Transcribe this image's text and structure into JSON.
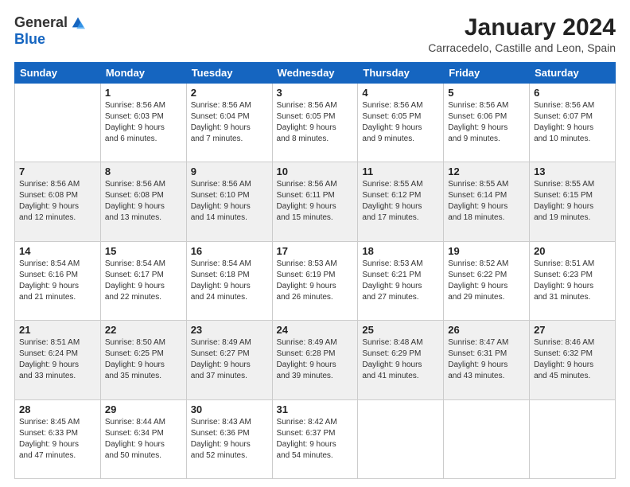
{
  "logo": {
    "general": "General",
    "blue": "Blue"
  },
  "title": "January 2024",
  "subtitle": "Carracedelo, Castille and Leon, Spain",
  "days_header": [
    "Sunday",
    "Monday",
    "Tuesday",
    "Wednesday",
    "Thursday",
    "Friday",
    "Saturday"
  ],
  "weeks": [
    [
      {
        "day": "",
        "info": ""
      },
      {
        "day": "1",
        "info": "Sunrise: 8:56 AM\nSunset: 6:03 PM\nDaylight: 9 hours\nand 6 minutes."
      },
      {
        "day": "2",
        "info": "Sunrise: 8:56 AM\nSunset: 6:04 PM\nDaylight: 9 hours\nand 7 minutes."
      },
      {
        "day": "3",
        "info": "Sunrise: 8:56 AM\nSunset: 6:05 PM\nDaylight: 9 hours\nand 8 minutes."
      },
      {
        "day": "4",
        "info": "Sunrise: 8:56 AM\nSunset: 6:05 PM\nDaylight: 9 hours\nand 9 minutes."
      },
      {
        "day": "5",
        "info": "Sunrise: 8:56 AM\nSunset: 6:06 PM\nDaylight: 9 hours\nand 9 minutes."
      },
      {
        "day": "6",
        "info": "Sunrise: 8:56 AM\nSunset: 6:07 PM\nDaylight: 9 hours\nand 10 minutes."
      }
    ],
    [
      {
        "day": "7",
        "info": ""
      },
      {
        "day": "8",
        "info": "Sunrise: 8:56 AM\nSunset: 6:08 PM\nDaylight: 9 hours\nand 13 minutes."
      },
      {
        "day": "9",
        "info": "Sunrise: 8:56 AM\nSunset: 6:10 PM\nDaylight: 9 hours\nand 14 minutes."
      },
      {
        "day": "10",
        "info": "Sunrise: 8:56 AM\nSunset: 6:11 PM\nDaylight: 9 hours\nand 15 minutes."
      },
      {
        "day": "11",
        "info": "Sunrise: 8:55 AM\nSunset: 6:12 PM\nDaylight: 9 hours\nand 17 minutes."
      },
      {
        "day": "12",
        "info": "Sunrise: 8:55 AM\nSunset: 6:14 PM\nDaylight: 9 hours\nand 18 minutes."
      },
      {
        "day": "13",
        "info": "Sunrise: 8:55 AM\nSunset: 6:15 PM\nDaylight: 9 hours\nand 19 minutes."
      }
    ],
    [
      {
        "day": "14",
        "info": ""
      },
      {
        "day": "15",
        "info": "Sunrise: 8:54 AM\nSunset: 6:17 PM\nDaylight: 9 hours\nand 22 minutes."
      },
      {
        "day": "16",
        "info": "Sunrise: 8:54 AM\nSunset: 6:18 PM\nDaylight: 9 hours\nand 24 minutes."
      },
      {
        "day": "17",
        "info": "Sunrise: 8:53 AM\nSunset: 6:19 PM\nDaylight: 9 hours\nand 26 minutes."
      },
      {
        "day": "18",
        "info": "Sunrise: 8:53 AM\nSunset: 6:21 PM\nDaylight: 9 hours\nand 27 minutes."
      },
      {
        "day": "19",
        "info": "Sunrise: 8:52 AM\nSunset: 6:22 PM\nDaylight: 9 hours\nand 29 minutes."
      },
      {
        "day": "20",
        "info": "Sunrise: 8:51 AM\nSunset: 6:23 PM\nDaylight: 9 hours\nand 31 minutes."
      }
    ],
    [
      {
        "day": "21",
        "info": ""
      },
      {
        "day": "22",
        "info": "Sunrise: 8:50 AM\nSunset: 6:25 PM\nDaylight: 9 hours\nand 35 minutes."
      },
      {
        "day": "23",
        "info": "Sunrise: 8:49 AM\nSunset: 6:27 PM\nDaylight: 9 hours\nand 37 minutes."
      },
      {
        "day": "24",
        "info": "Sunrise: 8:49 AM\nSunset: 6:28 PM\nDaylight: 9 hours\nand 39 minutes."
      },
      {
        "day": "25",
        "info": "Sunrise: 8:48 AM\nSunset: 6:29 PM\nDaylight: 9 hours\nand 41 minutes."
      },
      {
        "day": "26",
        "info": "Sunrise: 8:47 AM\nSunset: 6:31 PM\nDaylight: 9 hours\nand 43 minutes."
      },
      {
        "day": "27",
        "info": "Sunrise: 8:46 AM\nSunset: 6:32 PM\nDaylight: 9 hours\nand 45 minutes."
      }
    ],
    [
      {
        "day": "28",
        "info": ""
      },
      {
        "day": "29",
        "info": "Sunrise: 8:44 AM\nSunset: 6:34 PM\nDaylight: 9 hours\nand 50 minutes."
      },
      {
        "day": "30",
        "info": "Sunrise: 8:43 AM\nSunset: 6:36 PM\nDaylight: 9 hours\nand 52 minutes."
      },
      {
        "day": "31",
        "info": "Sunrise: 8:42 AM\nSunset: 6:37 PM\nDaylight: 9 hours\nand 54 minutes."
      },
      {
        "day": "",
        "info": ""
      },
      {
        "day": "",
        "info": ""
      },
      {
        "day": "",
        "info": ""
      }
    ]
  ],
  "week0_sunday_info": "Sunrise: 8:56 AM\nSunset: 6:08 PM\nDaylight: 9 hours\nand 12 minutes.",
  "week1_sunday_info": "Sunrise: 8:56 AM\nSunset: 6:08 PM\nDaylight: 9 hours\nand 12 minutes.",
  "week2_sunday_info": "Sunrise: 8:54 AM\nSunset: 6:16 PM\nDaylight: 9 hours\nand 21 minutes.",
  "week3_sunday_info": "Sunrise: 8:51 AM\nSunset: 6:24 PM\nDaylight: 9 hours\nand 33 minutes.",
  "week4_sunday_info": "Sunrise: 8:45 AM\nSunset: 6:33 PM\nDaylight: 9 hours\nand 47 minutes."
}
